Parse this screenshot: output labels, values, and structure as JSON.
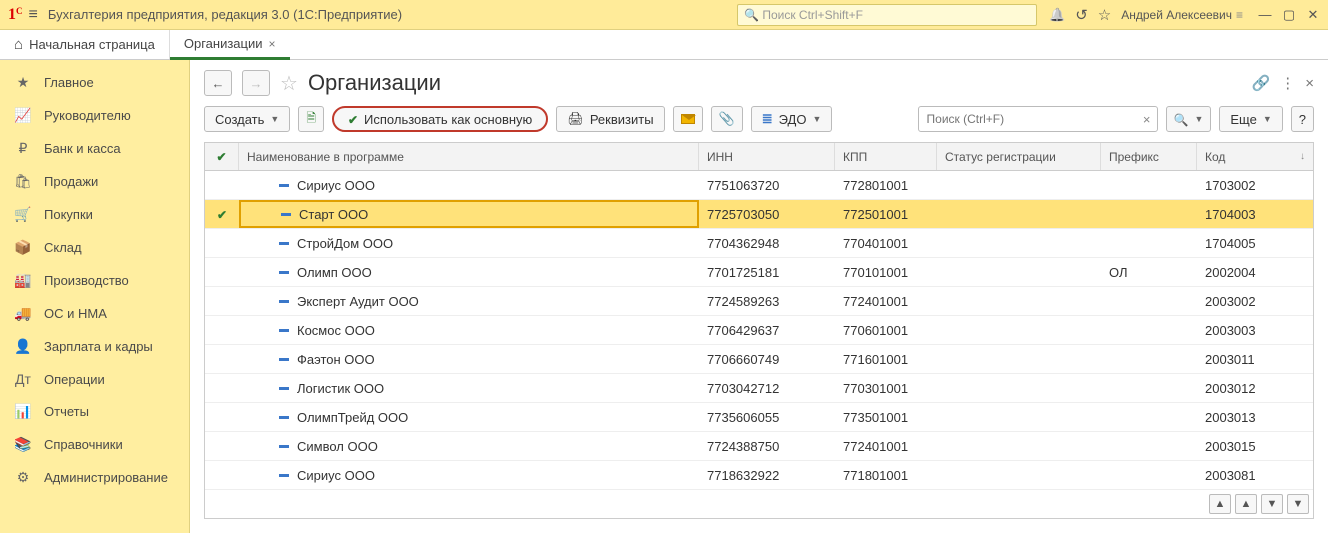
{
  "app": {
    "title": "Бухгалтерия предприятия, редакция 3.0  (1С:Предприятие)",
    "search_placeholder": "Поиск Ctrl+Shift+F",
    "user": "Андрей Алексеевич"
  },
  "tabs": {
    "home": "Начальная страница",
    "active": "Организации"
  },
  "sidebar": [
    {
      "icon": "★",
      "label": "Главное"
    },
    {
      "icon": "📈",
      "label": "Руководителю"
    },
    {
      "icon": "₽",
      "label": "Банк и касса"
    },
    {
      "icon": "🛍",
      "label": "Продажи"
    },
    {
      "icon": "🛒",
      "label": "Покупки"
    },
    {
      "icon": "📦",
      "label": "Склад"
    },
    {
      "icon": "🏭",
      "label": "Производство"
    },
    {
      "icon": "🚚",
      "label": "ОС и НМА"
    },
    {
      "icon": "👤",
      "label": "Зарплата и кадры"
    },
    {
      "icon": "Дт",
      "label": "Операции"
    },
    {
      "icon": "📊",
      "label": "Отчеты"
    },
    {
      "icon": "📚",
      "label": "Справочники"
    },
    {
      "icon": "⚙",
      "label": "Администрирование"
    }
  ],
  "page": {
    "title": "Организации",
    "btn_create": "Создать",
    "btn_use_main": "Использовать как основную",
    "btn_requisites": "Реквизиты",
    "btn_edo": "ЭДО",
    "btn_more": "Еще",
    "btn_help": "?",
    "search_placeholder": "Поиск (Ctrl+F)"
  },
  "grid": {
    "columns": {
      "name": "Наименование в программе",
      "inn": "ИНН",
      "kpp": "КПП",
      "status": "Статус регистрации",
      "prefix": "Префикс",
      "code": "Код"
    },
    "rows": [
      {
        "sel": false,
        "chk": false,
        "name": "Сириус ООО",
        "inn": "7751063720",
        "kpp": "772801001",
        "status": "",
        "prefix": "",
        "code": "1703002"
      },
      {
        "sel": true,
        "chk": true,
        "name": "Старт ООО",
        "inn": "7725703050",
        "kpp": "772501001",
        "status": "",
        "prefix": "",
        "code": "1704003"
      },
      {
        "sel": false,
        "chk": false,
        "name": "СтройДом ООО",
        "inn": "7704362948",
        "kpp": "770401001",
        "status": "",
        "prefix": "",
        "code": "1704005"
      },
      {
        "sel": false,
        "chk": false,
        "name": "Олимп ООО",
        "inn": "7701725181",
        "kpp": "770101001",
        "status": "",
        "prefix": "ОЛ",
        "code": "2002004"
      },
      {
        "sel": false,
        "chk": false,
        "name": "Эксперт Аудит ООО",
        "inn": "7724589263",
        "kpp": "772401001",
        "status": "",
        "prefix": "",
        "code": "2003002"
      },
      {
        "sel": false,
        "chk": false,
        "name": "Космос ООО",
        "inn": "7706429637",
        "kpp": "770601001",
        "status": "",
        "prefix": "",
        "code": "2003003"
      },
      {
        "sel": false,
        "chk": false,
        "name": "Фаэтон ООО",
        "inn": "7706660749",
        "kpp": "771601001",
        "status": "",
        "prefix": "",
        "code": "2003011"
      },
      {
        "sel": false,
        "chk": false,
        "name": "Логистик ООО",
        "inn": "7703042712",
        "kpp": "770301001",
        "status": "",
        "prefix": "",
        "code": "2003012"
      },
      {
        "sel": false,
        "chk": false,
        "name": "ОлимпТрейд ООО",
        "inn": "7735606055",
        "kpp": "773501001",
        "status": "",
        "prefix": "",
        "code": "2003013"
      },
      {
        "sel": false,
        "chk": false,
        "name": "Символ ООО",
        "inn": "7724388750",
        "kpp": "772401001",
        "status": "",
        "prefix": "",
        "code": "2003015"
      },
      {
        "sel": false,
        "chk": false,
        "name": "Сириус ООО",
        "inn": "7718632922",
        "kpp": "771801001",
        "status": "",
        "prefix": "",
        "code": "2003081"
      }
    ]
  }
}
